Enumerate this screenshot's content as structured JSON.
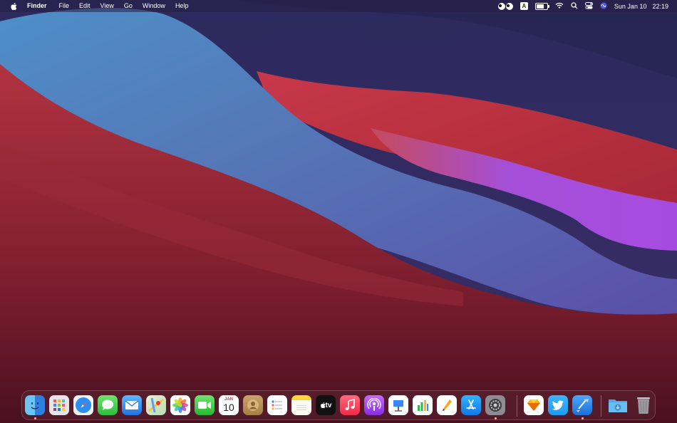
{
  "menubar": {
    "apple_icon": "apple-icon",
    "app_name": "Finder",
    "menus": [
      "File",
      "Edit",
      "View",
      "Go",
      "Window",
      "Help"
    ],
    "status": {
      "input_source": "A",
      "battery_level_percent": 75,
      "date": "Sun Jan 10",
      "time": "22:19"
    }
  },
  "dock": {
    "calendar": {
      "month": "JAN",
      "day": "10"
    },
    "tv_label": "tv",
    "apps": [
      {
        "name": "finder",
        "icon": "finder-icon",
        "running": true
      },
      {
        "name": "launchpad",
        "icon": "launchpad-icon",
        "running": false
      },
      {
        "name": "safari",
        "icon": "safari-icon",
        "running": false
      },
      {
        "name": "messages",
        "icon": "messages-icon",
        "running": false
      },
      {
        "name": "mail",
        "icon": "mail-icon",
        "running": false
      },
      {
        "name": "maps",
        "icon": "maps-icon",
        "running": false
      },
      {
        "name": "photos",
        "icon": "photos-icon",
        "running": false
      },
      {
        "name": "facetime",
        "icon": "facetime-icon",
        "running": false
      },
      {
        "name": "calendar",
        "icon": "calendar-icon",
        "running": false
      },
      {
        "name": "contacts",
        "icon": "contacts-icon",
        "running": false
      },
      {
        "name": "reminders",
        "icon": "reminders-icon",
        "running": false
      },
      {
        "name": "notes",
        "icon": "notes-icon",
        "running": false
      },
      {
        "name": "apple-tv",
        "icon": "tv-icon",
        "running": false
      },
      {
        "name": "music",
        "icon": "music-icon",
        "running": false
      },
      {
        "name": "podcasts",
        "icon": "podcasts-icon",
        "running": false
      },
      {
        "name": "keynote",
        "icon": "keynote-icon",
        "running": false
      },
      {
        "name": "numbers",
        "icon": "numbers-icon",
        "running": false
      },
      {
        "name": "pages",
        "icon": "pages-icon",
        "running": false
      },
      {
        "name": "app-store",
        "icon": "app-store-icon",
        "running": false
      },
      {
        "name": "system-preferences",
        "icon": "gear-icon",
        "running": true
      },
      {
        "name": "sketch",
        "icon": "sketch-icon",
        "running": false
      },
      {
        "name": "twitter",
        "icon": "twitter-icon",
        "running": false
      },
      {
        "name": "xcode",
        "icon": "xcode-icon",
        "running": true
      },
      {
        "name": "downloads",
        "icon": "downloads-folder-icon",
        "running": false
      },
      {
        "name": "trash",
        "icon": "trash-icon",
        "running": false
      }
    ]
  }
}
